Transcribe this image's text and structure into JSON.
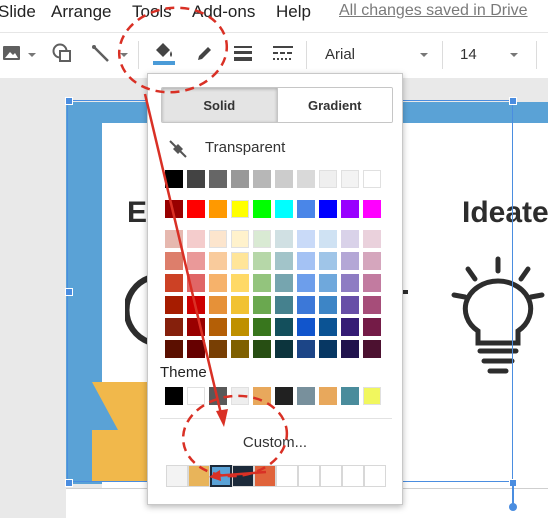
{
  "menubar": {
    "items": [
      "Slide",
      "Arrange",
      "Tools",
      "Add-ons",
      "Help"
    ],
    "status": "All changes saved in Drive"
  },
  "toolbar": {
    "icons": [
      "image-icon",
      "shape-icon",
      "line-icon",
      "fill-color-icon",
      "border-color-icon",
      "border-weight-icon",
      "border-dash-icon"
    ],
    "font": "Arial",
    "font_size": "14"
  },
  "slide": {
    "word_left": "E",
    "word_right": "Ideate"
  },
  "fill_dropdown": {
    "tabs": [
      "Solid",
      "Gradient"
    ],
    "active_tab": "Solid",
    "transparent_label": "Transparent",
    "grayscale": [
      "#000000",
      "#434343",
      "#666666",
      "#999999",
      "#b7b7b7",
      "#cccccc",
      "#d9d9d9",
      "#efefef",
      "#f3f3f3",
      "#ffffff"
    ],
    "bright": [
      "#980000",
      "#ff0000",
      "#ff9900",
      "#ffff00",
      "#00ff00",
      "#00ffff",
      "#4a86e8",
      "#0000ff",
      "#9900ff",
      "#ff00ff"
    ],
    "shades": [
      [
        "#e6b8af",
        "#f4cccc",
        "#fce5cd",
        "#fff2cc",
        "#d9ead3",
        "#d0e0e3",
        "#c9daf8",
        "#cfe2f3",
        "#d9d2e9",
        "#ead1dc"
      ],
      [
        "#dd7e6b",
        "#ea9999",
        "#f9cb9c",
        "#ffe599",
        "#b6d7a8",
        "#a2c4c9",
        "#a4c2f4",
        "#9fc5e8",
        "#b4a7d6",
        "#d5a6bd"
      ],
      [
        "#cc4125",
        "#e06666",
        "#f6b26b",
        "#ffd966",
        "#93c47d",
        "#76a5af",
        "#6d9eeb",
        "#6fa8dc",
        "#8e7cc3",
        "#c27ba0"
      ],
      [
        "#a61c00",
        "#cc0000",
        "#e69138",
        "#f1c232",
        "#6aa84f",
        "#45818e",
        "#3c78d8",
        "#3d85c6",
        "#674ea7",
        "#a64d79"
      ],
      [
        "#85200c",
        "#990000",
        "#b45f06",
        "#bf9000",
        "#38761d",
        "#134f5c",
        "#1155cc",
        "#0b5394",
        "#351c75",
        "#741b47"
      ],
      [
        "#5b0f00",
        "#660000",
        "#783f04",
        "#7f6000",
        "#274e13",
        "#0c343d",
        "#1c4587",
        "#073763",
        "#20124d",
        "#4c1130"
      ]
    ],
    "theme_label": "Theme",
    "theme_colors": [
      "#000000",
      "#ffffff",
      "#595959",
      "#eeeeee",
      "#e8a85c",
      "#212121",
      "#78909c",
      "#e8a85c",
      "#4a8c9c",
      "#f1f75e"
    ],
    "custom_label": "Custom...",
    "custom_colors": [
      "#f3f3f3",
      "#e8b45a",
      "#5aa2d6",
      "#1c2a3a",
      "#e0633b",
      "#ffffff",
      "#ffffff",
      "#ffffff",
      "#ffffff",
      "#ffffff"
    ]
  },
  "colors": {
    "accent_blue": "#4a8de0",
    "annotation_red": "#d93025"
  }
}
